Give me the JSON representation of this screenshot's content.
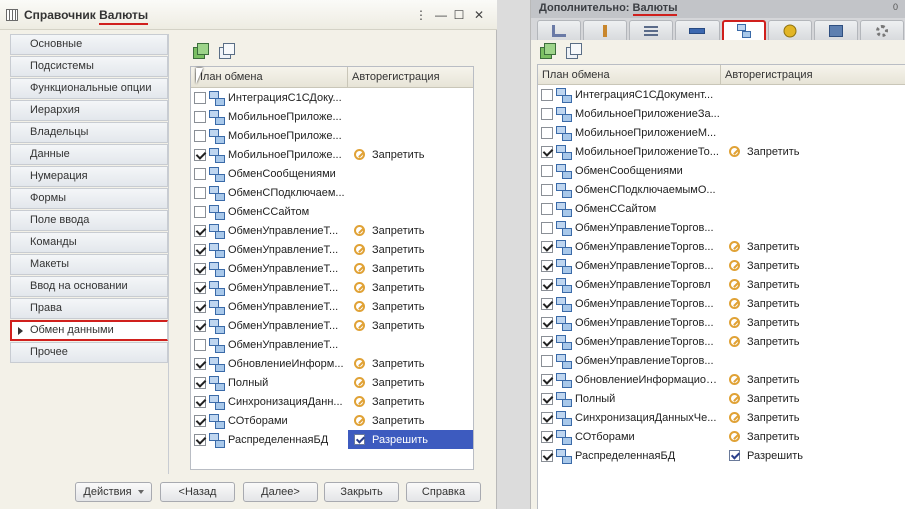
{
  "left_window": {
    "title_prefix": "Справочник",
    "title_highlight": "Валюты",
    "btn_more": "⋮",
    "btn_min": "—",
    "btn_max": "☐",
    "btn_close": "✕",
    "nav": [
      {
        "label": "Основные",
        "active": false
      },
      {
        "label": "Подсистемы",
        "active": false
      },
      {
        "label": "Функциональные опции",
        "active": false
      },
      {
        "label": "Иерархия",
        "active": false
      },
      {
        "label": "Владельцы",
        "active": false
      },
      {
        "label": "Данные",
        "active": false
      },
      {
        "label": "Нумерация",
        "active": false
      },
      {
        "label": "Формы",
        "active": false
      },
      {
        "label": "Поле ввода",
        "active": false
      },
      {
        "label": "Команды",
        "active": false
      },
      {
        "label": "Макеты",
        "active": false
      },
      {
        "label": "Ввод на основании",
        "active": false
      },
      {
        "label": "Права",
        "active": false
      },
      {
        "label": "Обмен данными",
        "active": true
      },
      {
        "label": "Прочее",
        "active": false
      }
    ],
    "grid": {
      "col_plan": "План обмена",
      "col_autoreg": "Авторегистрация",
      "rows": [
        {
          "name": "ИнтеграцияС1СДоку...",
          "checked": false,
          "autoreg": "",
          "selected": false
        },
        {
          "name": "МобильноеПриложе...",
          "checked": false,
          "autoreg": "",
          "selected": false
        },
        {
          "name": "МобильноеПриложе...",
          "checked": false,
          "autoreg": "",
          "selected": false
        },
        {
          "name": "МобильноеПриложе...",
          "checked": true,
          "autoreg": "Запретить",
          "selected": false
        },
        {
          "name": "ОбменСообщениями",
          "checked": false,
          "autoreg": "",
          "selected": false
        },
        {
          "name": "ОбменСПодключаем...",
          "checked": false,
          "autoreg": "",
          "selected": false
        },
        {
          "name": "ОбменССайтом",
          "checked": false,
          "autoreg": "",
          "selected": false
        },
        {
          "name": "ОбменУправлениеТ...",
          "checked": true,
          "autoreg": "Запретить",
          "selected": false
        },
        {
          "name": "ОбменУправлениеТ...",
          "checked": true,
          "autoreg": "Запретить",
          "selected": false
        },
        {
          "name": "ОбменУправлениеТ...",
          "checked": true,
          "autoreg": "Запретить",
          "selected": false
        },
        {
          "name": "ОбменУправлениеТ...",
          "checked": true,
          "autoreg": "Запретить",
          "selected": false
        },
        {
          "name": "ОбменУправлениеТ...",
          "checked": true,
          "autoreg": "Запретить",
          "selected": false
        },
        {
          "name": "ОбменУправлениеТ...",
          "checked": true,
          "autoreg": "Запретить",
          "selected": false
        },
        {
          "name": "ОбменУправлениеТ...",
          "checked": false,
          "autoreg": "",
          "selected": false
        },
        {
          "name": "ОбновлениеИнформ...",
          "checked": true,
          "autoreg": "Запретить",
          "selected": false
        },
        {
          "name": "Полный",
          "checked": true,
          "autoreg": "Запретить",
          "selected": false
        },
        {
          "name": "СинхронизацияДанн...",
          "checked": true,
          "autoreg": "Запретить",
          "selected": false
        },
        {
          "name": "СОтборами",
          "checked": true,
          "autoreg": "Запретить",
          "selected": false
        },
        {
          "name": "РаспределеннаяБД",
          "checked": true,
          "autoreg": "Разрешить",
          "selected": true
        }
      ]
    },
    "buttons": {
      "actions": "Действия",
      "back": "<Назад",
      "next": "Далее>",
      "close": "Закрыть",
      "help": "Справка"
    }
  },
  "right_window": {
    "title_prefix": "Дополнительно:",
    "title_highlight": "Валюты",
    "version_mark": "0",
    "tabs": [
      {
        "icon": "form-icon",
        "active": false
      },
      {
        "icon": "tool-icon",
        "active": false
      },
      {
        "icon": "list-icon",
        "active": false
      },
      {
        "icon": "bar-icon",
        "active": false
      },
      {
        "icon": "exchange-node-icon",
        "active": true
      },
      {
        "icon": "round-arrow-icon",
        "active": false
      },
      {
        "icon": "export-icon",
        "active": false
      },
      {
        "icon": "gear-icon",
        "active": false
      }
    ],
    "grid": {
      "col_plan": "План обмена",
      "col_autoreg": "Авторегистрация",
      "rows": [
        {
          "name": "ИнтеграцияС1СДокумент...",
          "checked": false,
          "autoreg": ""
        },
        {
          "name": "МобильноеПриложениеЗа...",
          "checked": false,
          "autoreg": ""
        },
        {
          "name": "МобильноеПриложениеМ...",
          "checked": false,
          "autoreg": ""
        },
        {
          "name": "МобильноеПриложениеТо...",
          "checked": true,
          "autoreg": "Запретить"
        },
        {
          "name": "ОбменСообщениями",
          "checked": false,
          "autoreg": ""
        },
        {
          "name": "ОбменСПодключаемымО...",
          "checked": false,
          "autoreg": ""
        },
        {
          "name": "ОбменССайтом",
          "checked": false,
          "autoreg": ""
        },
        {
          "name": "ОбменУправлениеТоргов...",
          "checked": false,
          "autoreg": ""
        },
        {
          "name": "ОбменУправлениеТоргов...",
          "checked": true,
          "autoreg": "Запретить"
        },
        {
          "name": "ОбменУправлениеТоргов...",
          "checked": true,
          "autoreg": "Запретить"
        },
        {
          "name": "ОбменУправлениеТорговл",
          "checked": true,
          "autoreg": "Запретить"
        },
        {
          "name": "ОбменУправлениеТоргов...",
          "checked": true,
          "autoreg": "Запретить"
        },
        {
          "name": "ОбменУправлениеТоргов...",
          "checked": true,
          "autoreg": "Запретить"
        },
        {
          "name": "ОбменУправлениеТоргов...",
          "checked": true,
          "autoreg": "Запретить"
        },
        {
          "name": "ОбменУправлениеТоргов...",
          "checked": false,
          "autoreg": ""
        },
        {
          "name": "ОбновлениеИнформацион...",
          "checked": true,
          "autoreg": "Запретить"
        },
        {
          "name": "Полный",
          "checked": true,
          "autoreg": "Запретить"
        },
        {
          "name": "СинхронизацияДанныхЧе...",
          "checked": true,
          "autoreg": "Запретить"
        },
        {
          "name": "СОтборами",
          "checked": true,
          "autoreg": "Запретить"
        },
        {
          "name": "РаспределеннаяБД",
          "checked": true,
          "autoreg": "Разрешить"
        }
      ]
    }
  }
}
